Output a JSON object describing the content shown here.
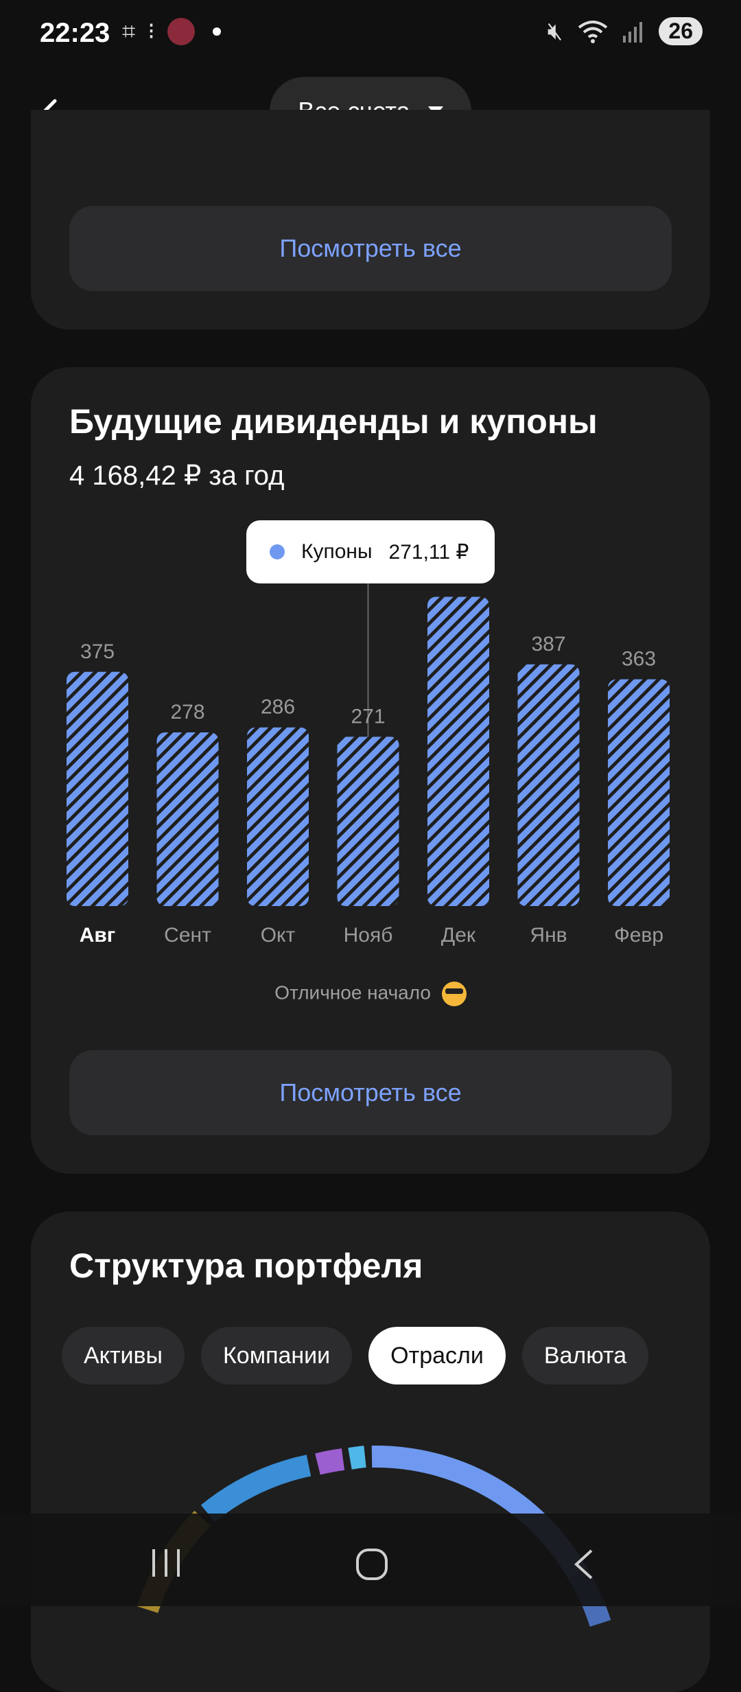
{
  "status_bar": {
    "time": "22:23",
    "icons_left": [
      "screenshot-icon",
      "steps-icon",
      "avatar-icon"
    ],
    "icons_right": [
      "mute-icon",
      "wifi-icon",
      "signal-icon"
    ],
    "battery": "26"
  },
  "header": {
    "account_selector": "Все счета"
  },
  "top_card": {
    "view_all": "Посмотреть все"
  },
  "dividends_card": {
    "title": "Будущие дивиденды и купоны",
    "subtitle": "4 168,42 ₽ за год",
    "tooltip": {
      "label": "Купоны",
      "value": "271,11 ₽"
    },
    "note": "Отличное начало",
    "view_all": "Посмотреть все"
  },
  "chart_data": {
    "type": "bar",
    "categories": [
      "Авг",
      "Сент",
      "Окт",
      "Нояб",
      "Дек",
      "Янв",
      "Февр"
    ],
    "values": [
      375,
      278,
      286,
      271,
      495,
      387,
      363
    ],
    "value_labels": [
      "375",
      "278",
      "286",
      "271",
      "",
      "387",
      "363"
    ],
    "active_category": "Авг",
    "selected_category": "Нояб",
    "colors": {
      "bar": "#6f99f0",
      "stripe": "#1e1e1e"
    }
  },
  "structure_card": {
    "title": "Структура портфеля",
    "tabs": [
      {
        "label": "Активы",
        "active": false
      },
      {
        "label": "Компании",
        "active": false
      },
      {
        "label": "Отрасли",
        "active": true
      },
      {
        "label": "Валюта",
        "active": false
      }
    ],
    "donut_colors": [
      "#6f99f0",
      "#3a8fd6",
      "#4fb8e8",
      "#9b5fd0",
      "#a88a2e"
    ]
  },
  "nav_bar": {
    "recent_icon": "recent-apps-icon",
    "home_icon": "home-icon",
    "back_icon": "back-icon"
  }
}
